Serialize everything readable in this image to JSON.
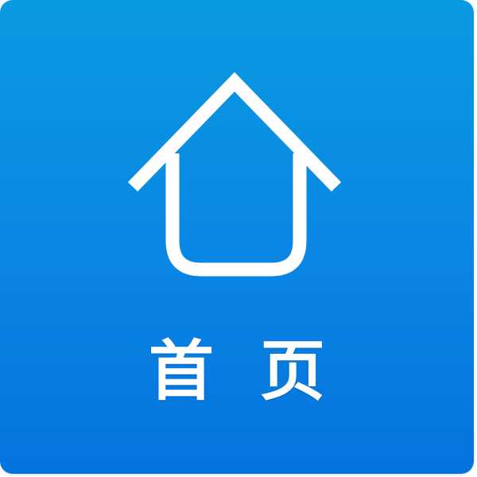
{
  "tile": {
    "label": "首页",
    "icon": "home-icon",
    "background_colors": [
      "#0a9ae0",
      "#0573dd"
    ],
    "foreground_color": "#ffffff"
  }
}
